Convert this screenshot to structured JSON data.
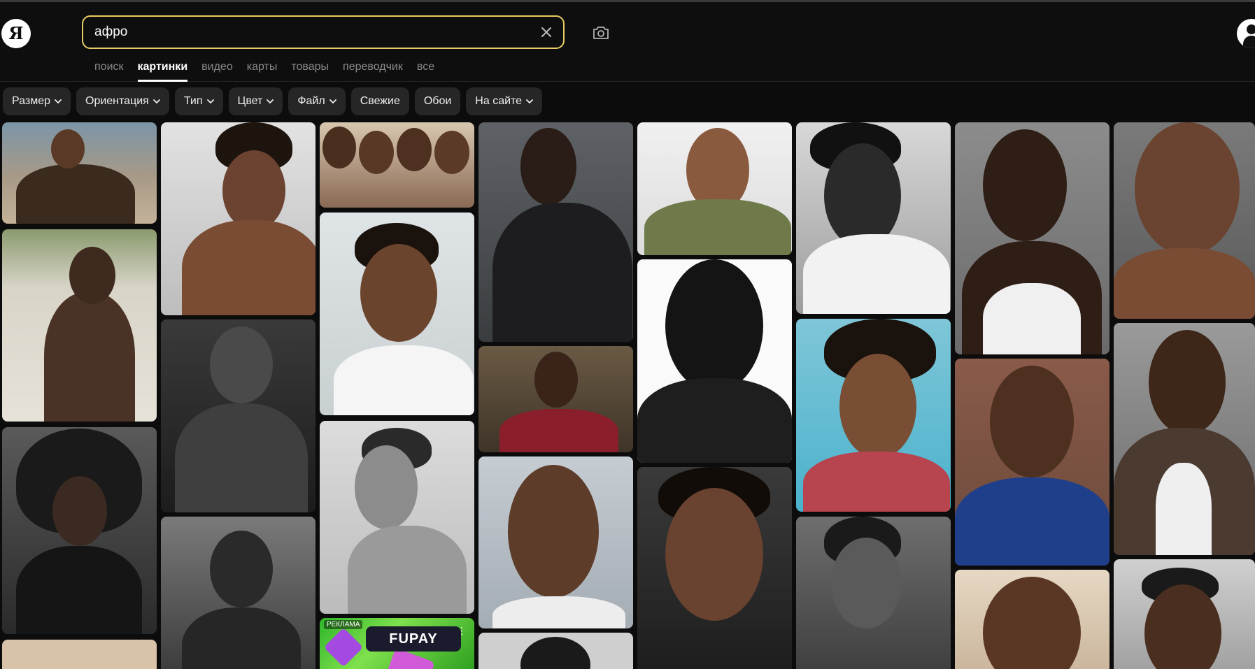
{
  "header": {
    "logo_letter": "Я",
    "search": {
      "value": "афро",
      "placeholder": ""
    },
    "tabs": [
      {
        "label": "поиск",
        "active": false
      },
      {
        "label": "картинки",
        "active": true
      },
      {
        "label": "видео",
        "active": false
      },
      {
        "label": "карты",
        "active": false
      },
      {
        "label": "товары",
        "active": false
      },
      {
        "label": "переводчик",
        "active": false
      },
      {
        "label": "все",
        "active": false
      }
    ]
  },
  "filters": [
    {
      "label": "Размер",
      "dropdown": true
    },
    {
      "label": "Ориентация",
      "dropdown": true
    },
    {
      "label": "Тип",
      "dropdown": true
    },
    {
      "label": "Цвет",
      "dropdown": true
    },
    {
      "label": "Файл",
      "dropdown": true
    },
    {
      "label": "Свежие",
      "dropdown": false
    },
    {
      "label": "Обои",
      "dropdown": false
    },
    {
      "label": "На сайте",
      "dropdown": true
    }
  ],
  "ad": {
    "label": "РЕКЛАМА",
    "brand": "FUPAY",
    "menu": "⋮"
  },
  "colors": {
    "accent_border": "#e7cd63",
    "background": "#0c0c0c",
    "chip_bg": "#262626"
  }
}
